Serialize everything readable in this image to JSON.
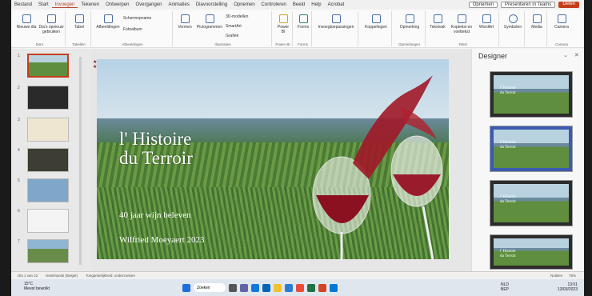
{
  "menu": {
    "tabs": [
      "Bestand",
      "Start",
      "Invoegen",
      "Tekenen",
      "Ontwerpen",
      "Overgangen",
      "Animaties",
      "Diavoorstelling",
      "Opnemen",
      "Controleren",
      "Beeld",
      "Help",
      "Acrobat"
    ],
    "active_tab": "Invoegen",
    "open_label": "Opnemen",
    "present_label": "Presenteren in Teams",
    "share_label": "Delen"
  },
  "ribbon": {
    "buttons": [
      "Nieuwe dia",
      "Dia's opnieuw gebruiken",
      "Tabel",
      "Afbeeldingen",
      "Schermopname",
      "Fotoalbum",
      "Vormen",
      "Pictogrammen",
      "3D-modellen",
      "SmartArt",
      "Grafiek",
      "Power BI",
      "Forms",
      "Invoegtoepassingen",
      "Koppelingen",
      "Opmerking",
      "Tekstvak",
      "Koptekst en voettekst",
      "WordArt",
      "Symbolen",
      "Media",
      "Camera"
    ],
    "groups": [
      "Dia's",
      "Tabellen",
      "Afbeeldingen",
      "Illustraties",
      "Power BI",
      "Forms",
      "Opmerkingen",
      "Tekst",
      "Camera"
    ]
  },
  "thumbnails": [
    "1",
    "2",
    "3",
    "4",
    "5",
    "6",
    "7"
  ],
  "slide": {
    "title_line1": "l' Histoire",
    "title_line2": "du Terroir",
    "subtitle": "40 jaar wijn beleven",
    "author": "Wilfried Moeyaert  2023"
  },
  "designer": {
    "title": "Designer",
    "card_text_line1": "l' Histoire",
    "card_text_line2": "du Terroir"
  },
  "status": {
    "slide_count": "Dia 1 van 22",
    "language": "Nederlands (België)",
    "accessibility": "Toegankelijkheid: onderzoeken",
    "notes": "Notities",
    "zoom": "76%"
  },
  "taskbar": {
    "temperature": "15°C",
    "weather": "Meest bewolkt",
    "search_label": "Zoeken",
    "lang_line1": "NLD",
    "lang_line2": "BEP",
    "time": "13:01",
    "date": "13/03/2023"
  },
  "colors": {
    "accent": "#c43e1c",
    "ribbon_bg": "#fafafa"
  }
}
